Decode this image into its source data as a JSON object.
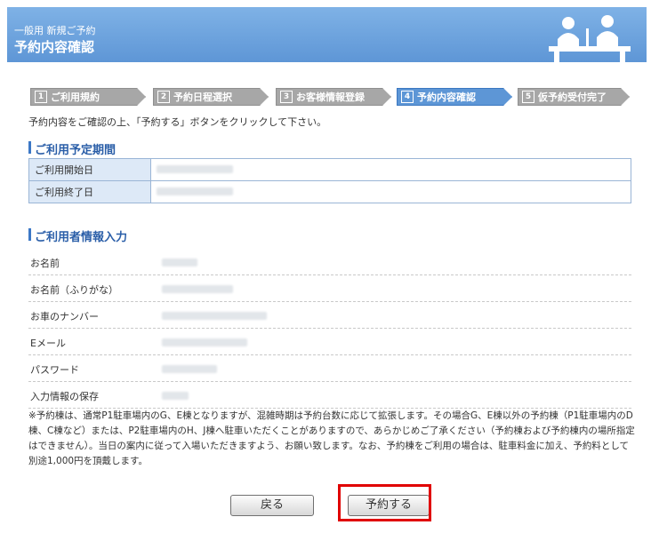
{
  "header": {
    "subtitle": "一般用 新規ご予約",
    "title": "予約内容確認"
  },
  "steps": [
    {
      "num": "1",
      "label": "ご利用規約"
    },
    {
      "num": "2",
      "label": "予約日程選択"
    },
    {
      "num": "3",
      "label": "お客様情報登録"
    },
    {
      "num": "4",
      "label": "予約内容確認"
    },
    {
      "num": "5",
      "label": "仮予約受付完了"
    }
  ],
  "lead_text": "予約内容をご確認の上、「予約する」ボタンをクリックして下さい。",
  "period_section": {
    "title": "ご利用予定期間",
    "rows": [
      {
        "label": "ご利用開始日"
      },
      {
        "label": "ご利用終了日"
      }
    ]
  },
  "user_section": {
    "title": "ご利用者情報入力",
    "rows": [
      {
        "label": "お名前"
      },
      {
        "label": "お名前（ふりがな）"
      },
      {
        "label": "お車のナンバー"
      },
      {
        "label": "Eメール"
      },
      {
        "label": "パスワード"
      },
      {
        "label": "入力情報の保存"
      }
    ]
  },
  "note": "※予約棟は、通常P1駐車場内のG、E棟となりますが、混雑時期は予約台数に応じて拡張します。その場合G、E棟以外の予約棟（P1駐車場内のD棟、C棟など）または、P2駐車場内のH、J棟へ駐車いただくことがありますので、あらかじめご了承ください（予約棟および予約棟内の場所指定はできません）。当日の案内に従って入場いただきますよう、お願い致します。なお、予約棟をご利用の場合は、駐車料金に加え、予約料として別途1,000円を頂戴します。",
  "buttons": {
    "back": "戻る",
    "reserve": "予約する"
  },
  "colors": {
    "header_blue": "#6ea5e0",
    "active_step": "#5d96d6",
    "highlight": "#e00000"
  }
}
